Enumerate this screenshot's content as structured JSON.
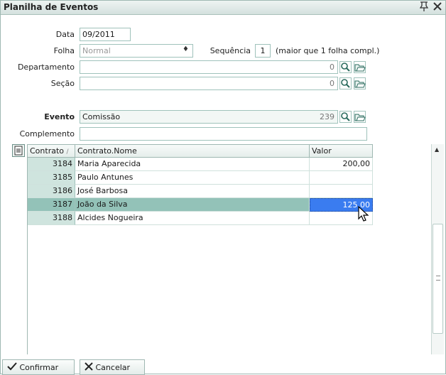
{
  "window": {
    "title": "Planilha de Eventos"
  },
  "form": {
    "data_label": "Data",
    "data_value": "09/2011",
    "folha_label": "Folha",
    "folha_value": "Normal",
    "sequencia_label": "Sequência",
    "sequencia_value": "1",
    "sequencia_hint": "(maior que 1 folha compl.)",
    "departamento_label": "Departamento",
    "departamento_value": "",
    "departamento_code": "0",
    "secao_label": "Seção",
    "secao_value": "",
    "secao_code": "0",
    "evento_label": "Evento",
    "evento_value": "Comissão",
    "evento_code": "239",
    "complemento_label": "Complemento",
    "complemento_value": ""
  },
  "grid": {
    "columns": [
      "Contrato",
      "Contrato.Nome",
      "Valor"
    ],
    "sort_indicator": "/",
    "rows": [
      {
        "contrato": "3184",
        "nome": "Maria Aparecida",
        "valor": "200,00"
      },
      {
        "contrato": "3185",
        "nome": "Paulo Antunes",
        "valor": ""
      },
      {
        "contrato": "3186",
        "nome": "José Barbosa",
        "valor": ""
      },
      {
        "contrato": "3187",
        "nome": "João da Silva",
        "valor": "125,00"
      },
      {
        "contrato": "3188",
        "nome": "Alcides Nogueira",
        "valor": ""
      }
    ],
    "selected_row": 3
  },
  "buttons": {
    "confirmar": "Confirmar",
    "cancelar": "Cancelar"
  },
  "icons": {
    "pin": "pin-icon",
    "close": "close-icon",
    "search": "magnifier-icon",
    "open": "folder-open-icon",
    "grid_menu": "grid-menu-icon",
    "confirm": "check-icon",
    "cancel": "x-icon"
  },
  "colors": {
    "accent": "#3a7cf0",
    "field_border": "#9fc2bb",
    "code_column": "#cfe4de"
  }
}
